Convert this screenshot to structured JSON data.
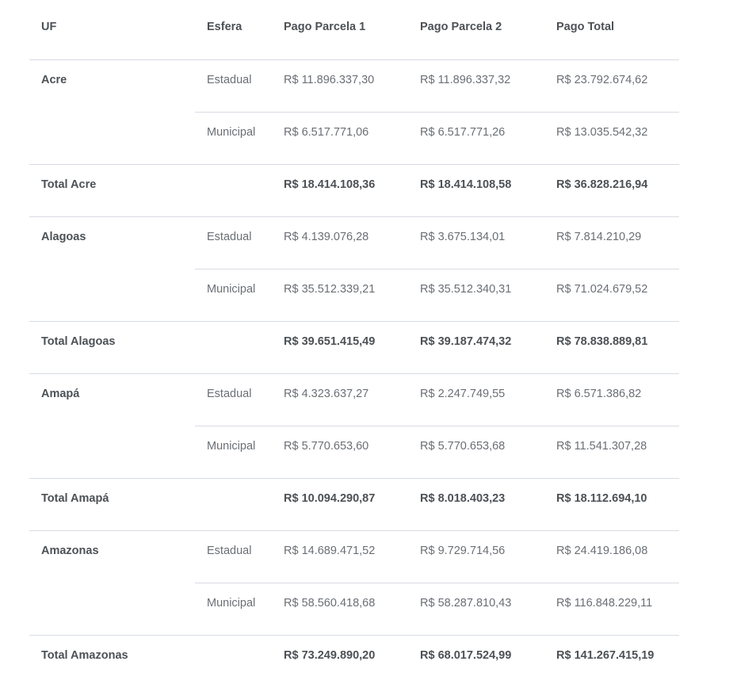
{
  "table": {
    "headers": {
      "uf": "UF",
      "esfera": "Esfera",
      "p1": "Pago Parcela 1",
      "p2": "Pago Parcela 2",
      "total": "Pago Total"
    },
    "states": [
      {
        "name": "Acre",
        "rows": [
          {
            "esfera": "Estadual",
            "p1": "R$ 11.896.337,30",
            "p2": "R$ 11.896.337,32",
            "total": "R$ 23.792.674,62"
          },
          {
            "esfera": "Municipal",
            "p1": "R$ 6.517.771,06",
            "p2": "R$ 6.517.771,26",
            "total": "R$ 13.035.542,32"
          }
        ],
        "total_label": "Total Acre",
        "totals": {
          "p1": "R$ 18.414.108,36",
          "p2": "R$ 18.414.108,58",
          "total": "R$ 36.828.216,94"
        }
      },
      {
        "name": "Alagoas",
        "rows": [
          {
            "esfera": "Estadual",
            "p1": "R$ 4.139.076,28",
            "p2": "R$ 3.675.134,01",
            "total": "R$ 7.814.210,29"
          },
          {
            "esfera": "Municipal",
            "p1": "R$ 35.512.339,21",
            "p2": "R$ 35.512.340,31",
            "total": "R$ 71.024.679,52"
          }
        ],
        "total_label": "Total Alagoas",
        "totals": {
          "p1": "R$ 39.651.415,49",
          "p2": "R$ 39.187.474,32",
          "total": "R$ 78.838.889,81"
        }
      },
      {
        "name": "Amapá",
        "rows": [
          {
            "esfera": "Estadual",
            "p1": "R$ 4.323.637,27",
            "p2": "R$ 2.247.749,55",
            "total": "R$ 6.571.386,82"
          },
          {
            "esfera": "Municipal",
            "p1": "R$ 5.770.653,60",
            "p2": "R$ 5.770.653,68",
            "total": "R$ 11.541.307,28"
          }
        ],
        "total_label": "Total Amapá",
        "totals": {
          "p1": "R$ 10.094.290,87",
          "p2": "R$ 8.018.403,23",
          "total": "R$ 18.112.694,10"
        }
      },
      {
        "name": "Amazonas",
        "rows": [
          {
            "esfera": "Estadual",
            "p1": "R$ 14.689.471,52",
            "p2": "R$ 9.729.714,56",
            "total": "R$ 24.419.186,08"
          },
          {
            "esfera": "Municipal",
            "p1": "R$ 58.560.418,68",
            "p2": "R$ 58.287.810,43",
            "total": "R$ 116.848.229,11"
          }
        ],
        "total_label": "Total Amazonas",
        "totals": {
          "p1": "R$ 73.249.890,20",
          "p2": "R$ 68.017.524,99",
          "total": "R$ 141.267.415,19"
        }
      }
    ]
  }
}
